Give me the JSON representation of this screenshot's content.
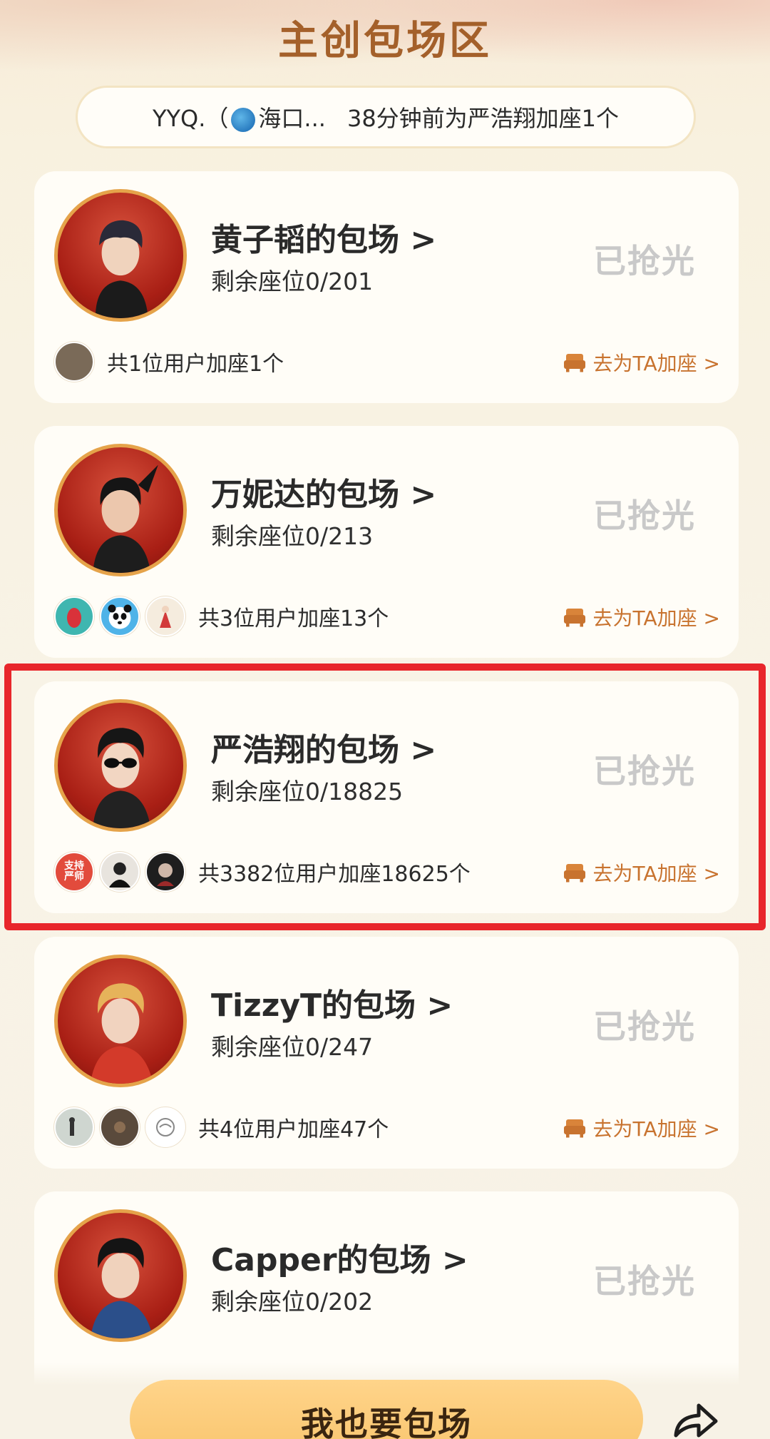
{
  "header": {
    "title": "主创包场区"
  },
  "ticker": {
    "user": "YYQ.（",
    "location": "海口...",
    "message": "38分钟前为严浩翔加座1个"
  },
  "cards": [
    {
      "name": "黄子韬的包场 >",
      "seats": "剩余座位0/201",
      "status": "已抢光",
      "fans_summary": "共1位用户加座1个",
      "add_link": "去为TA加座 >",
      "highlighted": false
    },
    {
      "name": "万妮达的包场 >",
      "seats": "剩余座位0/213",
      "status": "已抢光",
      "fans_summary": "共3位用户加座13个",
      "add_link": "去为TA加座 >",
      "highlighted": false
    },
    {
      "name": "严浩翔的包场 >",
      "seats": "剩余座位0/18825",
      "status": "已抢光",
      "fans_summary": "共3382位用户加座18625个",
      "add_link": "去为TA加座 >",
      "highlighted": true,
      "first_fan_badge": "支持严师"
    },
    {
      "name": "TizzyT的包场 >",
      "seats": "剩余座位0/247",
      "status": "已抢光",
      "fans_summary": "共4位用户加座47个",
      "add_link": "去为TA加座 >",
      "highlighted": false
    },
    {
      "name": "Capper的包场 >",
      "seats": "剩余座位0/202",
      "status": "已抢光",
      "highlighted": false
    }
  ],
  "bottom": {
    "cta_label": "我也要包场",
    "share_icon": "share-arrow-icon"
  },
  "colors": {
    "title": "#a4602a",
    "accent": "#c8732f",
    "sold_out": "#c9c9c9",
    "highlight_border": "#e8262b",
    "cta": "#f9c56e"
  }
}
